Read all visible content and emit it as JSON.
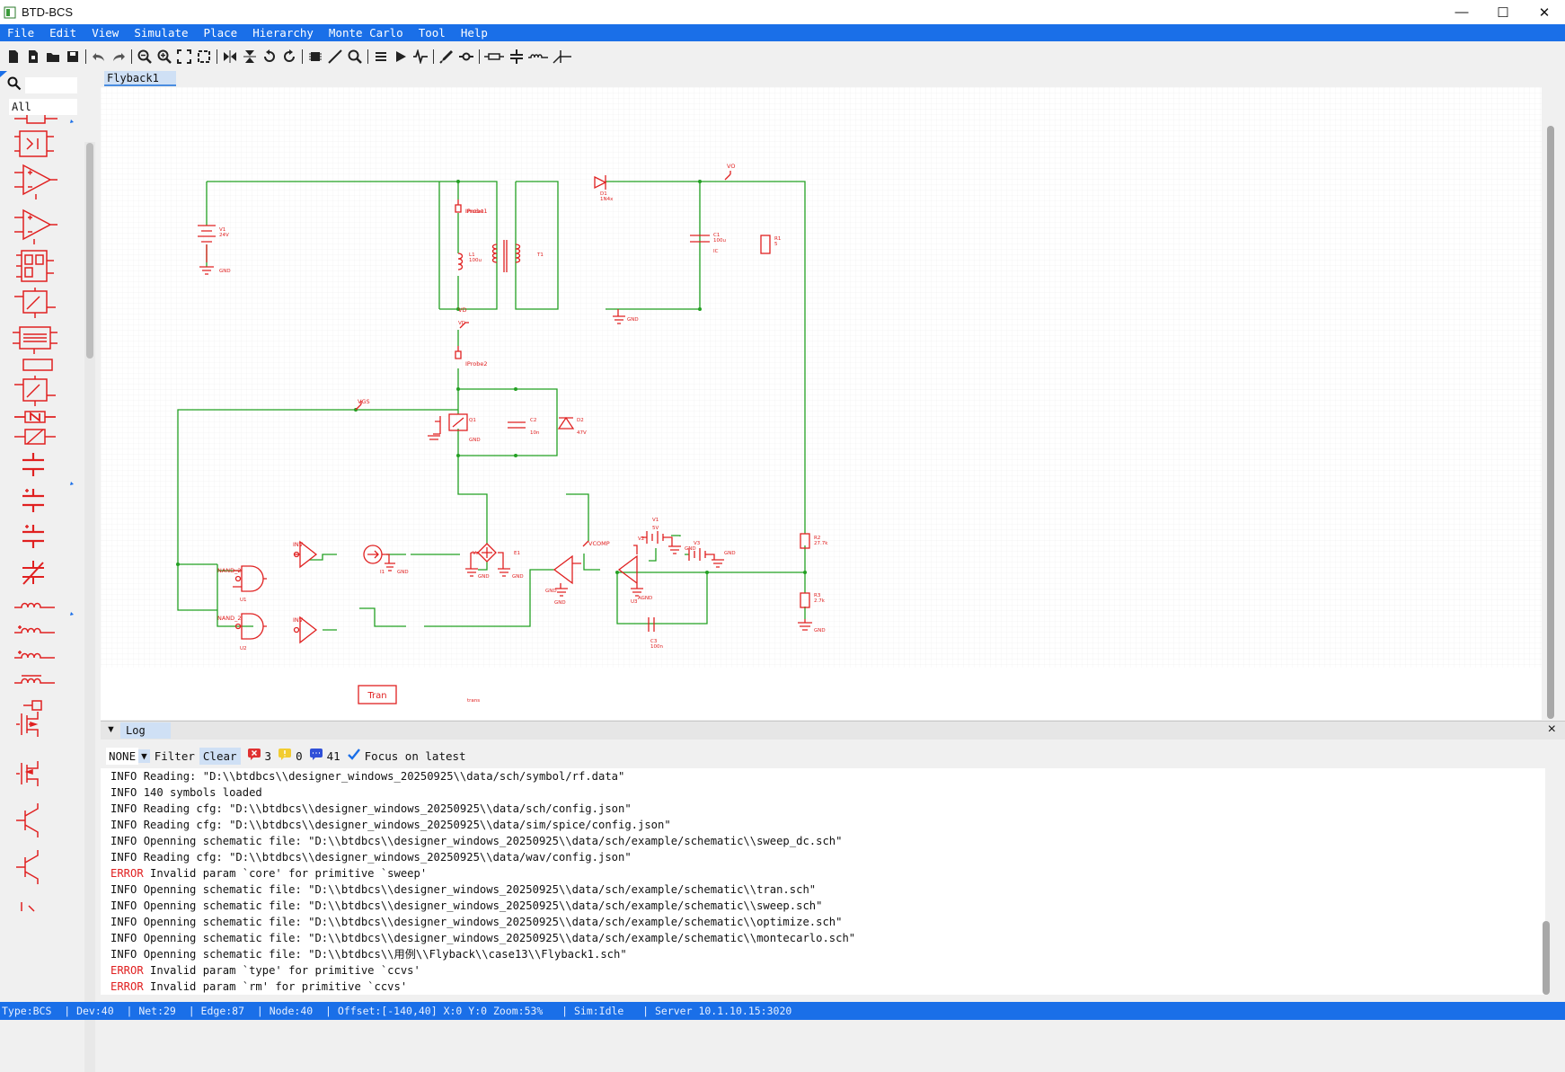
{
  "window": {
    "title": "BTD-BCS",
    "controls": [
      "—",
      "☐",
      "✕"
    ]
  },
  "menu": [
    "File",
    "Edit",
    "View",
    "Simulate",
    "Place",
    "Hierarchy",
    "Monte Carlo",
    "Tool",
    "Help"
  ],
  "palette": {
    "category": "All"
  },
  "tabs": {
    "active": "Flyback1"
  },
  "schematic": {
    "labels": {
      "vo": "VO",
      "vgs": "VGS",
      "iprobe1": "IProbe1",
      "iprobe2": "IProbe2",
      "nand1": "NAND_2",
      "nand2": "NAND_2",
      "inv1": "INV",
      "inv2": "INV",
      "vcomp": "VCOMP",
      "tran": "Tran",
      "vd": "VD"
    }
  },
  "log": {
    "tab": "Log",
    "filter_level": "NONE",
    "filter_label": "Filter",
    "clear_label": "Clear",
    "error_count": "3",
    "warning_count": "0",
    "info_count": "41",
    "focus_label": "Focus on latest",
    "lines": [
      {
        "level": "INFO",
        "text": " Reading: \"D:\\\\btdbcs\\\\designer_windows_20250925\\\\data/sch/symbol/rf.data\""
      },
      {
        "level": "INFO",
        "text": " 140 symbols loaded"
      },
      {
        "level": "INFO",
        "text": " Reading cfg: \"D:\\\\btdbcs\\\\designer_windows_20250925\\\\data/sch/config.json\""
      },
      {
        "level": "INFO",
        "text": " Reading cfg: \"D:\\\\btdbcs\\\\designer_windows_20250925\\\\data/sim/spice/config.json\""
      },
      {
        "level": "INFO",
        "text": " Openning schematic file: \"D:\\\\btdbcs\\\\designer_windows_20250925\\\\data/sch/example/schematic\\\\sweep_dc.sch\""
      },
      {
        "level": "INFO",
        "text": " Reading cfg: \"D:\\\\btdbcs\\\\designer_windows_20250925\\\\data/wav/config.json\""
      },
      {
        "level": "ERROR",
        "text": " Invalid param `core' for primitive `sweep'"
      },
      {
        "level": "INFO",
        "text": " Openning schematic file: \"D:\\\\btdbcs\\\\designer_windows_20250925\\\\data/sch/example/schematic\\\\tran.sch\""
      },
      {
        "level": "INFO",
        "text": " Openning schematic file: \"D:\\\\btdbcs\\\\designer_windows_20250925\\\\data/sch/example/schematic\\\\sweep.sch\""
      },
      {
        "level": "INFO",
        "text": " Openning schematic file: \"D:\\\\btdbcs\\\\designer_windows_20250925\\\\data/sch/example/schematic\\\\optimize.sch\""
      },
      {
        "level": "INFO",
        "text": " Openning schematic file: \"D:\\\\btdbcs\\\\designer_windows_20250925\\\\data/sch/example/schematic\\\\montecarlo.sch\""
      },
      {
        "level": "INFO",
        "text": " Openning schematic file: \"D:\\\\btdbcs\\\\用例\\\\Flyback\\\\case13\\\\Flyback1.sch\""
      },
      {
        "level": "ERROR",
        "text": " Invalid param `type' for primitive `ccvs'"
      },
      {
        "level": "ERROR",
        "text": " Invalid param `rm' for primitive `ccvs'"
      }
    ]
  },
  "status": "Type:BCS  | Dev:40  | Net:29  | Edge:87  | Node:40  | Offset:[-140,40] X:0 Y:0 Zoom:53%   | Sim:Idle   | Server 10.1.10.15:3020",
  "colors": {
    "accent": "#1a6fe8",
    "wire": "#22a022",
    "component": "#e02020"
  }
}
